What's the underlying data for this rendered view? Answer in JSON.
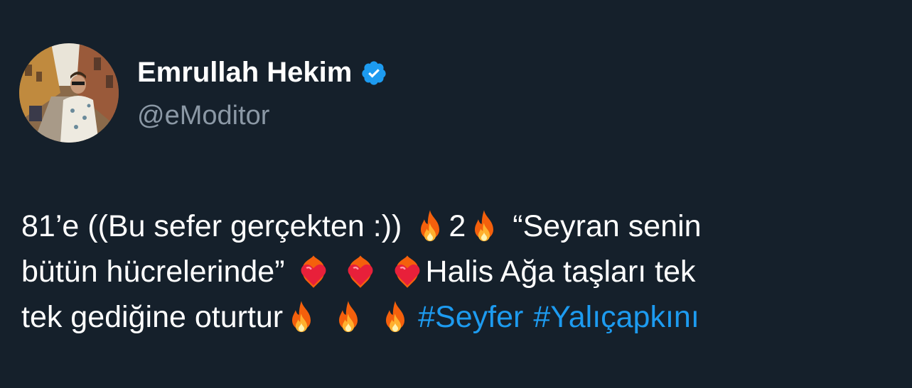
{
  "author": {
    "display_name": "Emrullah Hekim",
    "handle": "@eModitor",
    "verified": true,
    "verified_color": "#1d9bf0"
  },
  "tweet": {
    "line1": {
      "text_a": "81’e ((Bu sefer gerçekten :))",
      "text_b": "2",
      "text_c": "“Seyran senin"
    },
    "line2": {
      "text_a": "bütün hücrelerinde”",
      "text_b": "Halis Ağa taşları tek"
    },
    "line3": {
      "text_a": "tek gediğine oturtur",
      "hashtag_1": "#Seyfer",
      "hashtag_2": "#Yalıçapkını"
    },
    "emoji_icons": [
      "fire-icon",
      "heart-on-fire-icon"
    ],
    "link_color": "#1d9bf0"
  },
  "theme": {
    "background": "#15202b",
    "text_primary": "#ffffff",
    "text_secondary": "#8b98a5"
  }
}
